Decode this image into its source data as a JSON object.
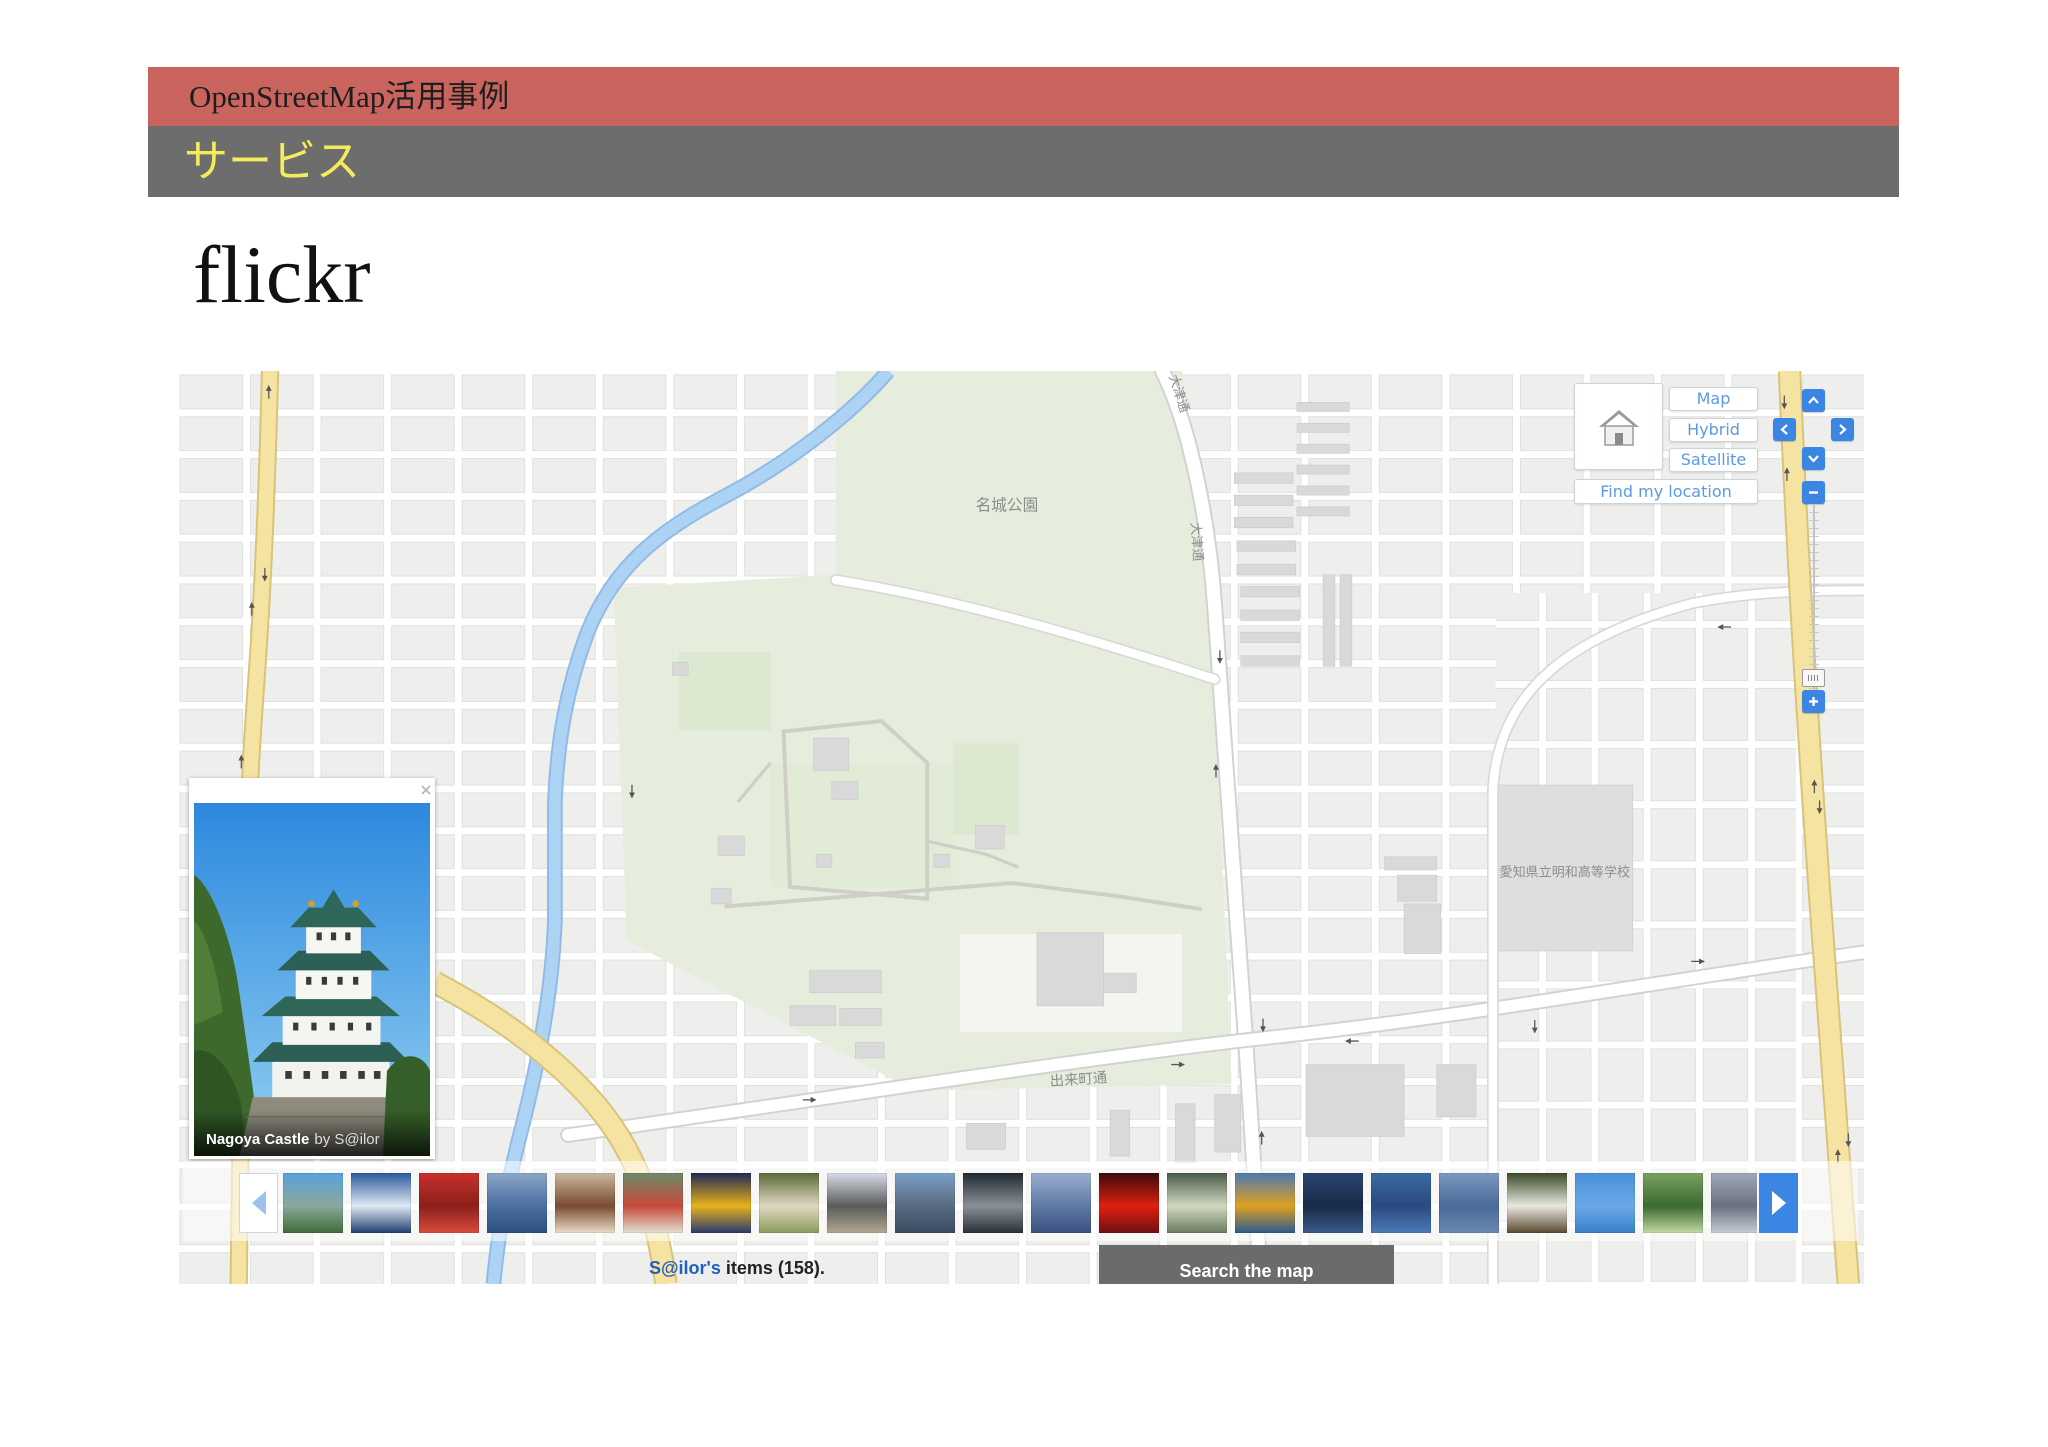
{
  "slide": {
    "header_title": "OpenStreetMap活用事例",
    "section_title": "サービス",
    "title": "flickr"
  },
  "theme": {
    "header_red": "#c9655e",
    "header_gray": "#6d6d6d",
    "section_yellow": "#f5ec5a",
    "link_blue": "#1f5fbf",
    "control_blue": "#3b86e3",
    "control_text": "#5a9ae6"
  },
  "map": {
    "labels": {
      "park": "名城公園",
      "school": "愛知県立明和高等学校",
      "street_dekimachi": "出来町通",
      "street_otsu": "大津通"
    },
    "controls": {
      "home_icon": "home-icon",
      "map_types": [
        "Map",
        "Hybrid",
        "Satellite"
      ],
      "find_my_location": "Find my location",
      "pan_icons": [
        "chevron-up-icon",
        "chevron-left-icon",
        "chevron-right-icon",
        "chevron-down-icon"
      ],
      "zoom_out_icon": "minus-icon",
      "zoom_in_icon": "plus-icon",
      "zoom_level_fraction": 0.98
    },
    "photo_popup": {
      "title": "Nagoya Castle",
      "byline": "by S@ilor",
      "close_icon": "close-icon"
    },
    "filmstrip": {
      "prev_icon": "triangle-left-icon",
      "next_icon": "triangle-right-icon",
      "thumbnails": [
        {
          "colors": [
            "#5aa0e0",
            "#8aa89a",
            "#3f6b3a"
          ]
        },
        {
          "colors": [
            "#2b5a9c",
            "#dfe8f2",
            "#1e3e70"
          ]
        },
        {
          "colors": [
            "#c8302c",
            "#8b1f1a",
            "#d94b3f"
          ]
        },
        {
          "colors": [
            "#8aa6c8",
            "#4a6fa0",
            "#2d4f80"
          ]
        },
        {
          "colors": [
            "#c9b8a0",
            "#7a4a30",
            "#e8dcc8"
          ]
        },
        {
          "colors": [
            "#6a8a6a",
            "#c84a3a",
            "#e0e0d0"
          ]
        },
        {
          "colors": [
            "#1f2a55",
            "#e8b21c",
            "#2a3a70"
          ]
        },
        {
          "colors": [
            "#5a6a3a",
            "#e0d8c0",
            "#8a9a5a"
          ]
        },
        {
          "colors": [
            "#d8dce8",
            "#5a5a5a",
            "#b0a890"
          ]
        },
        {
          "colors": [
            "#7aa0c8",
            "#5a6a80",
            "#3a4a60"
          ]
        },
        {
          "colors": [
            "#202830",
            "#8a9098",
            "#2a3038"
          ]
        },
        {
          "colors": [
            "#9aaed0",
            "#5f7aa5",
            "#3a5080"
          ]
        },
        {
          "colors": [
            "#3a0a0a",
            "#e02010",
            "#701010"
          ]
        },
        {
          "colors": [
            "#4a5a4a",
            "#d0d8c0",
            "#6a7a60"
          ]
        },
        {
          "colors": [
            "#4a7ab0",
            "#e0a020",
            "#2a5a90"
          ]
        },
        {
          "colors": [
            "#2a4470",
            "#1a2a48",
            "#3a5a88"
          ]
        },
        {
          "colors": [
            "#3a6aa0",
            "#2a4a80",
            "#4a7ab8"
          ]
        },
        {
          "colors": [
            "#7a98c0",
            "#4a6a98",
            "#6a88b0"
          ]
        },
        {
          "colors": [
            "#3a4a2a",
            "#e8e8e0",
            "#5a4a30"
          ]
        },
        {
          "colors": [
            "#4a90d8",
            "#6aa8e8",
            "#3a80c8"
          ]
        },
        {
          "colors": [
            "#7aa060",
            "#3a6a30",
            "#c0d8a0"
          ]
        },
        {
          "colors": [
            "#a0a8b8",
            "#6a7080",
            "#c8ccd8"
          ]
        }
      ]
    },
    "footer": {
      "owner": "S@ilor's",
      "items": "items (158).",
      "search_button": "Search the map"
    }
  }
}
